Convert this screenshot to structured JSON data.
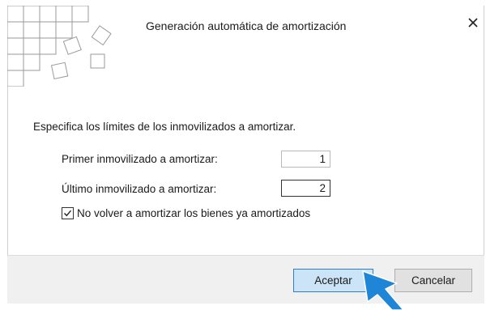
{
  "dialog": {
    "title": "Generación automática de amortización",
    "close_symbol": "×"
  },
  "content": {
    "instruction": "Especifica los límites de los inmovilizados a amortizar.",
    "fields": [
      {
        "label": "Primer inmovilizado a amortizar:",
        "value": "1"
      },
      {
        "label": "Último inmovilizado a amortizar:",
        "value": "2"
      }
    ],
    "checkbox": {
      "label": "No volver a amortizar los bienes ya amortizados",
      "checked": true
    }
  },
  "buttons": {
    "accept": "Aceptar",
    "cancel": "Cancelar"
  },
  "colors": {
    "accent": "#2f7dc4",
    "cursor": "#1f85d6",
    "footer_bg": "#f0f0f0"
  },
  "icons": {
    "logo": "app-logo-grid-squares",
    "close": "close-icon",
    "check": "checkmark-icon",
    "pointer": "mouse-pointer-icon"
  }
}
